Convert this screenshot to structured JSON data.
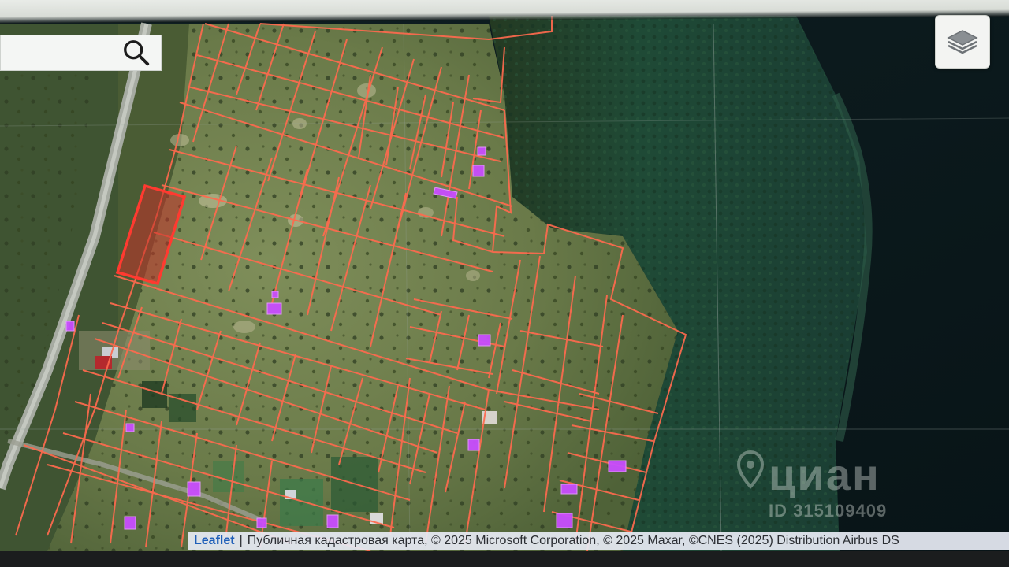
{
  "search": {
    "placeholder": "",
    "value": ""
  },
  "controls": {
    "layers_icon": "layers-icon",
    "search_icon": "search-icon"
  },
  "map": {
    "imagery": "satellite",
    "parcel_line_color": "#ff6a4e",
    "selected_parcel_color": "#ff3a30",
    "building_color": "#c94dff",
    "water_color": "#0b1a1d",
    "forest_color": "#1f4a36"
  },
  "watermark": {
    "brand": "циан",
    "listing_id": "ID 315109409"
  },
  "attribution": {
    "leaflet_link": "Leaflet",
    "separator": "|",
    "text": "Публичная кадастровая карта, © 2025 Microsoft Corporation, © 2025 Maxar, ©CNES (2025) Distribution Airbus DS"
  }
}
